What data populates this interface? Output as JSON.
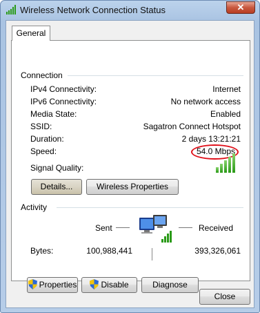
{
  "window": {
    "title": "Wireless Network Connection Status",
    "close_glyph": "✕"
  },
  "tabs": [
    {
      "label": "General"
    }
  ],
  "connection": {
    "header": "Connection",
    "rows": [
      {
        "label": "IPv4 Connectivity:",
        "value": "Internet"
      },
      {
        "label": "IPv6 Connectivity:",
        "value": "No network access"
      },
      {
        "label": "Media State:",
        "value": "Enabled"
      },
      {
        "label": "SSID:",
        "value": "Sagatron Connect Hotspot"
      },
      {
        "label": "Duration:",
        "value": "2 days 13:21:21"
      },
      {
        "label": "Speed:",
        "value": "54.0 Mbps"
      }
    ],
    "signal_label": "Signal Quality:",
    "signal_bars_lit": 5,
    "signal_bars_total": 5,
    "buttons": {
      "details": "Details...",
      "wireless_properties": "Wireless Properties"
    }
  },
  "activity": {
    "header": "Activity",
    "sent_label": "Sent",
    "received_label": "Received",
    "bytes_label": "Bytes:",
    "bytes_sent": "100,988,441",
    "bytes_received": "393,326,061"
  },
  "actions": {
    "properties": "Properties",
    "disable": "Disable",
    "diagnose": "Diagnose"
  },
  "footer": {
    "close": "Close"
  },
  "colors": {
    "highlight_circle": "#e0101a",
    "signal_green": "#2a9a17"
  },
  "icons": [
    "wifi-signal-icon",
    "network-computers-icon",
    "uac-shield-icon"
  ]
}
